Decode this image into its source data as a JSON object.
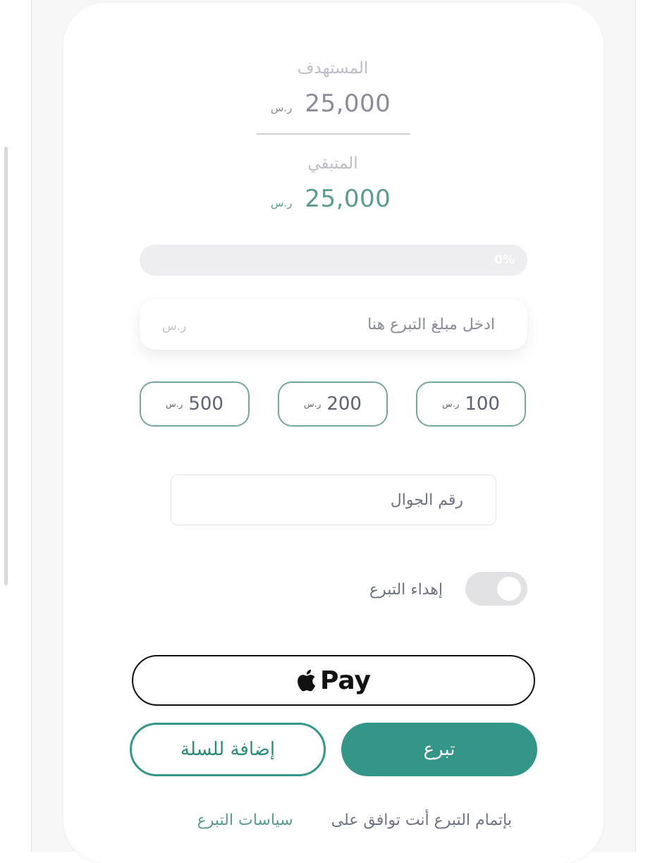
{
  "target": {
    "label": "المستهدف",
    "value": "25,000",
    "currency": "ر.س"
  },
  "remaining": {
    "label": "المتبقي",
    "value": "25,000",
    "currency": "ر.س"
  },
  "progress": {
    "percent": 0,
    "text": "0%"
  },
  "amount_input": {
    "placeholder": "ادخل مبلغ التبرع هنا",
    "currency": "ر.س"
  },
  "presets": [
    {
      "value": "500",
      "currency": "ر.س"
    },
    {
      "value": "200",
      "currency": "ر.س"
    },
    {
      "value": "100",
      "currency": "ر.س"
    }
  ],
  "phone": {
    "placeholder": "رقم الجوال"
  },
  "gift": {
    "label": "إهداء التبرع",
    "enabled": false
  },
  "apple_pay": {
    "label": "Pay"
  },
  "actions": {
    "add_to_cart": "إضافة للسلة",
    "donate": "تبرع"
  },
  "terms": {
    "text": "بإتمام التبرع أنت توافق على",
    "link": "سياسات التبرع"
  },
  "colors": {
    "accent": "#339688",
    "remaining": "#5b9b8f",
    "muted": "#bdbec6",
    "text": "#6f7281"
  }
}
